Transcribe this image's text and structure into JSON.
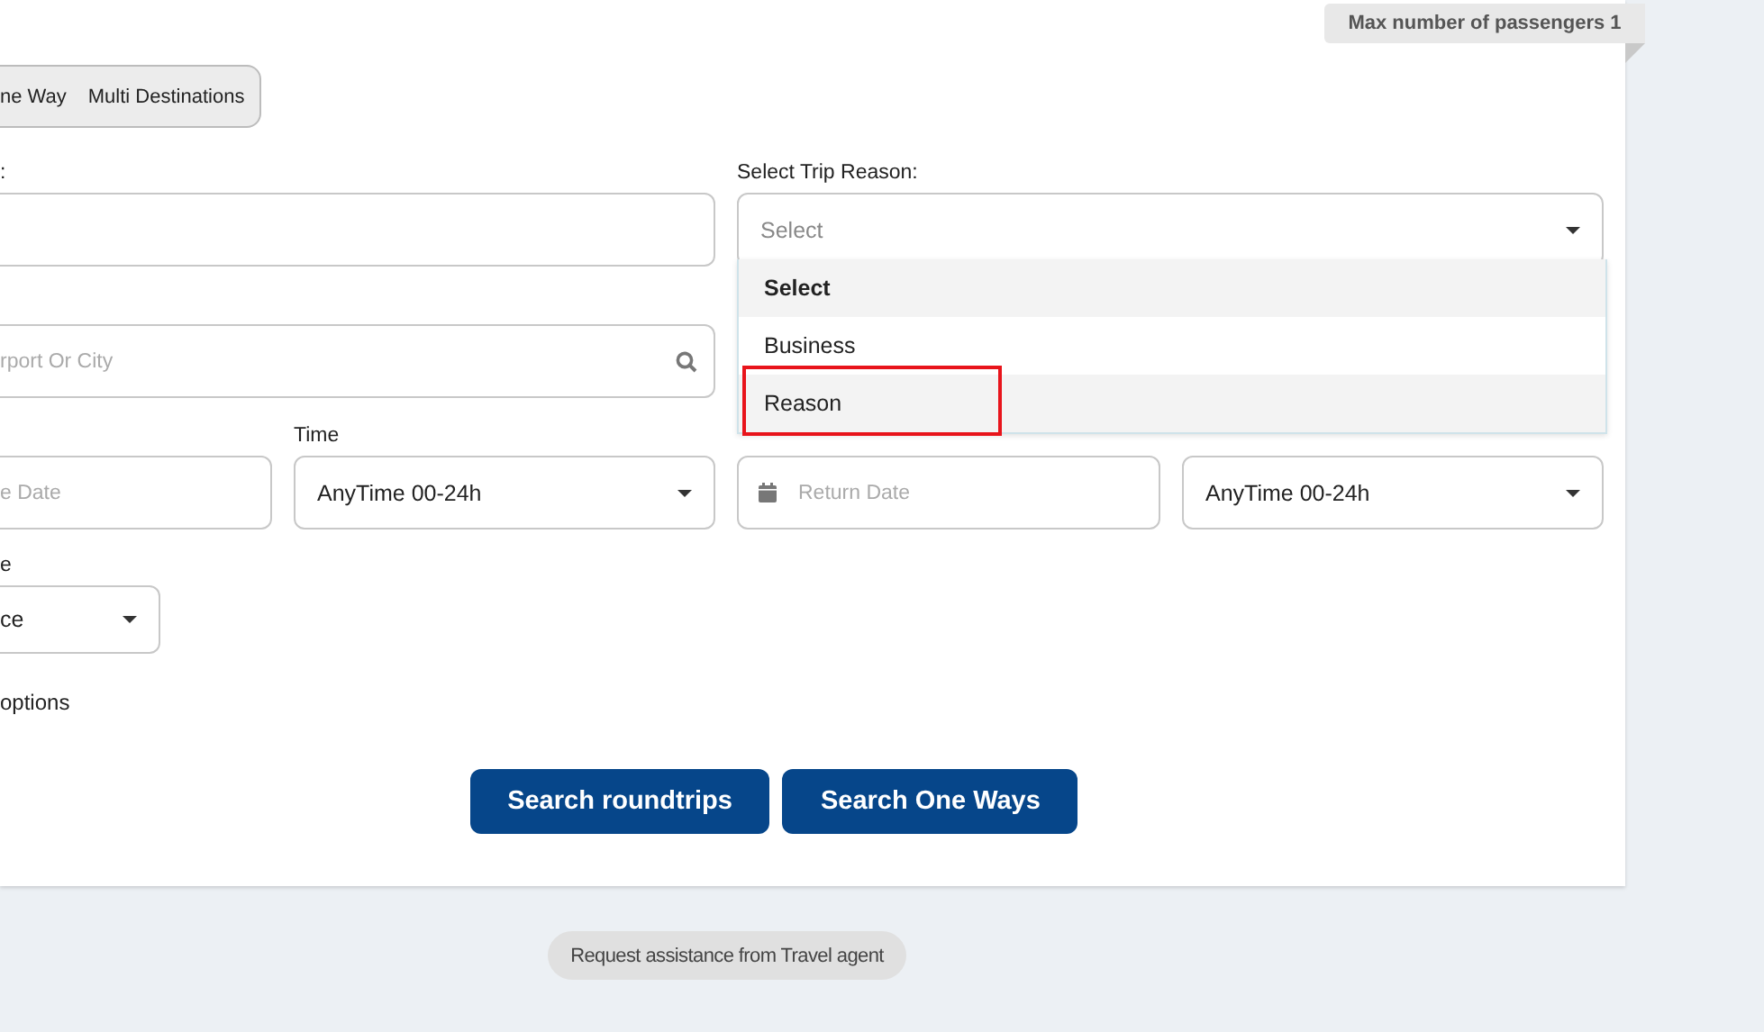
{
  "badge": {
    "text": "Max number of passengers 1"
  },
  "trip_types": [
    {
      "label": "ne Way",
      "selected": false
    },
    {
      "label": "Multi Destinations",
      "selected": false
    }
  ],
  "origin": {
    "label": ":"
  },
  "trip_reason": {
    "label": "Select Trip Reason:",
    "placeholder": "Select",
    "expanded": true,
    "options": [
      {
        "label": "Select",
        "kind": "header",
        "highlighted": true,
        "marked": false
      },
      {
        "label": "Business",
        "kind": "option",
        "highlighted": false,
        "marked": false
      },
      {
        "label": "Reason",
        "kind": "option",
        "highlighted": true,
        "marked": true
      }
    ]
  },
  "destination": {
    "placeholder": "rport Or City"
  },
  "departure_date": {
    "placeholder": "e Date"
  },
  "departure_time": {
    "label": "Time",
    "value": "AnyTime 00-24h"
  },
  "return_date": {
    "placeholder": "Return Date"
  },
  "return_time": {
    "value": "AnyTime 00-24h"
  },
  "cabin": {
    "label": "e",
    "value": "ce"
  },
  "options_link": "options",
  "buttons": [
    "Search roundtrips",
    "Search One Ways"
  ],
  "assistance": "Request assistance from Travel agent"
}
